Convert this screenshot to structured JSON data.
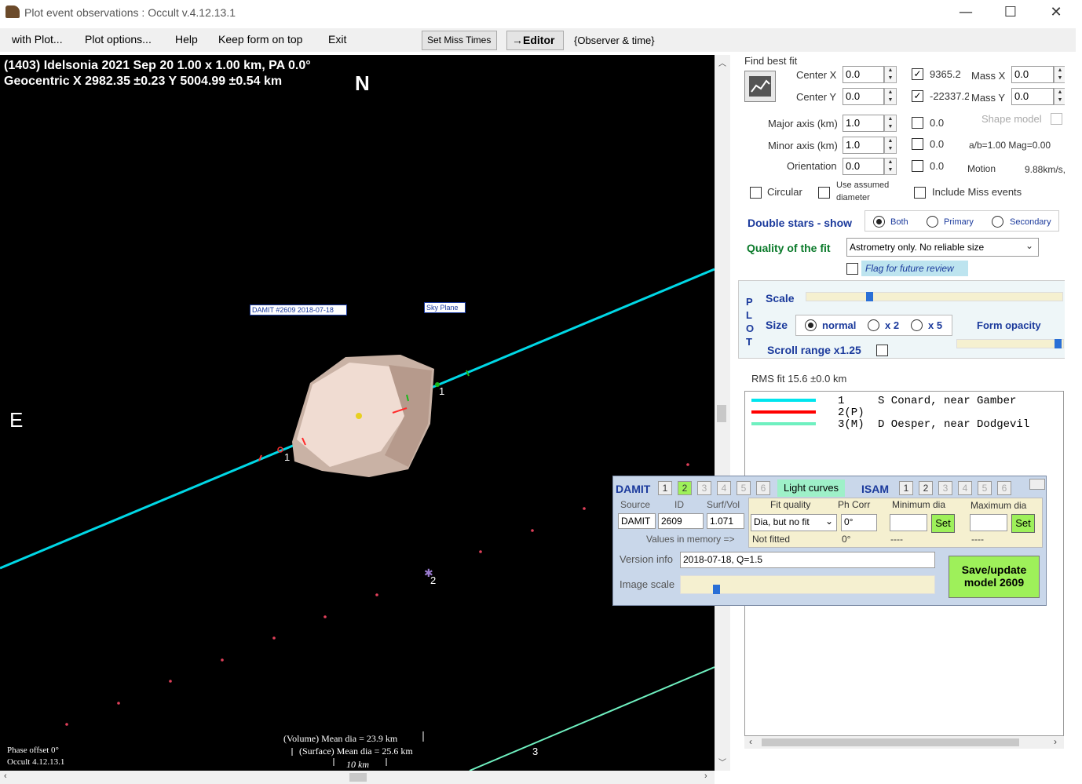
{
  "window": {
    "title": "Plot event observations : Occult v.4.12.13.1",
    "minimize": "—",
    "maximize": "☐",
    "close": "✕"
  },
  "menu": {
    "items": [
      "with Plot...",
      "Plot options...",
      "Help",
      "Keep form on top",
      "Exit"
    ],
    "set_miss_times": "Set Miss Times",
    "editor": "→Editor",
    "observer_time": "{Observer & time}"
  },
  "plot": {
    "header_line1": "(1403) Idelsonia  2021 Sep 20   1.00 x 1.00 km, PA 0.0°",
    "header_line2": "Geocentric  X  2982.35 ±0.23  Y 5004.99 ±0.54 km",
    "north": "N",
    "east": "E",
    "damit_label": "DAMIT #2609 2018-07-18",
    "sky_plane_label": "Sky Plane",
    "chord_labels": [
      "1",
      "1",
      "2",
      "3"
    ],
    "volume_dia": "(Volume) Mean dia = 23.9 km",
    "surface_dia": "(Surface) Mean dia = 25.6 km",
    "scale_bar": "10 km",
    "phase_offset": "Phase offset 0°",
    "occult_version": "Occult 4.12.13.1"
  },
  "fit": {
    "find_best_fit": "Find best fit",
    "center_x_label": "Center X",
    "center_x": "0.0",
    "center_y_label": "Center Y",
    "center_y": "0.0",
    "val_9365": "9365.2",
    "val_22337": "-22337.2",
    "mass_x_label": "Mass X",
    "mass_x": "0.0",
    "mass_y_label": "Mass Y",
    "mass_y": "0.0",
    "major_axis_label": "Major axis (km)",
    "major_axis": "1.0",
    "minor_axis_label": "Minor axis (km)",
    "minor_axis": "1.0",
    "orientation_label": "Orientation",
    "orientation": "0.0",
    "chk_vals": [
      "0.0",
      "0.0",
      "0.0"
    ],
    "shape_model": "Shape model",
    "ab_ratio": "a/b=1.00 Mag=0.00",
    "motion_label": "Motion",
    "motion": "9.88km/s,",
    "circular": "Circular",
    "use_assumed": "Use assumed",
    "diameter": "diameter",
    "include_miss": "Include Miss events",
    "double_stars": "Double stars - show",
    "both": "Both",
    "primary": "Primary",
    "secondary": "Secondary",
    "quality_label": "Quality of the fit",
    "quality_value": "Astrometry only. No reliable size",
    "flag_review": "Flag for future review"
  },
  "plotbox": {
    "vertical": [
      "P",
      "L",
      "O",
      "T"
    ],
    "scale": "Scale",
    "size": "Size",
    "normal": "normal",
    "x2": "x 2",
    "x5": "x 5",
    "form_opacity": "Form opacity",
    "scroll_range": "Scroll range x1.25"
  },
  "observers": {
    "rms": "RMS fit 15.6 ±0.0 km",
    "rows": [
      {
        "num": "1",
        "text": "S Conard, near Gamber",
        "color": "#00e5ee"
      },
      {
        "num": "2(P)",
        "text": "",
        "color": "#ff0000"
      },
      {
        "num": "3(M)",
        "text": "D Oesper, near Dodgevil",
        "color": "#6ff0c0"
      }
    ]
  },
  "damit": {
    "damit": "DAMIT",
    "damit_nums": [
      "1",
      "2",
      "3",
      "4",
      "5",
      "6"
    ],
    "light_curves": "Light curves",
    "isam": "ISAM",
    "isam_nums": [
      "1",
      "2",
      "3",
      "4",
      "5",
      "6"
    ],
    "source_label": "Source",
    "id_label": "ID",
    "surf_vol_label": "Surf/Vol",
    "source": "DAMIT",
    "id": "2609",
    "surf_vol": "1.071",
    "fit_quality_label": "Fit quality",
    "ph_corr_label": "Ph Corr",
    "min_dia_label": "Minimum dia",
    "max_dia_label": "Maximum dia",
    "fit_quality": "Dia, but no fit",
    "ph_corr": "0°",
    "set": "Set",
    "values_in_memory": "Values in memory =>",
    "not_fitted": "Not fitted",
    "ph_mem": "0°",
    "dashes": "----",
    "version_label": "Version info",
    "version": "2018-07-18, Q=1.5",
    "image_scale": "Image scale",
    "save_update": "Save/update",
    "model": "model 2609"
  }
}
